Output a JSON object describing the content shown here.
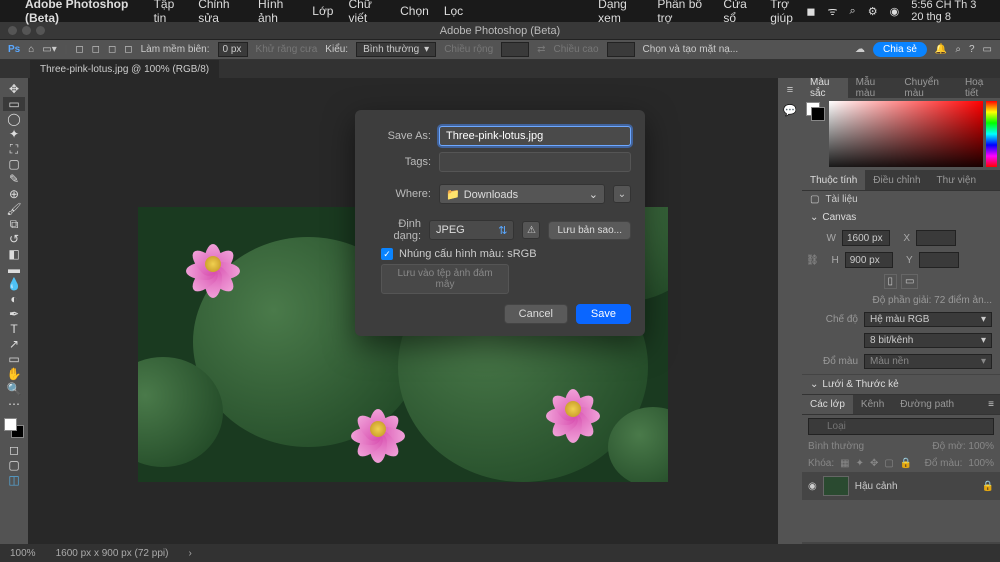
{
  "mac_menu": {
    "app": "Adobe Photoshop (Beta)",
    "items": [
      "Tập tin",
      "Chỉnh sửa",
      "Hình ảnh",
      "Lớp",
      "Chữ viết",
      "Chọn",
      "Lọc",
      "Dạng xem",
      "Phần bổ trợ",
      "Cửa sổ",
      "Trợ giúp"
    ],
    "clock": "5:56 CH Th 3 20 thg 8"
  },
  "window_title": "Adobe Photoshop (Beta)",
  "option_bar": {
    "feather_label": "Làm mềm biên:",
    "feather_value": "0 px",
    "antialias": "Khử răng cưa",
    "style_label": "Kiểu:",
    "style_value": "Bình thường",
    "width_label": "Chiều rộng",
    "height_label": "Chiều cao",
    "mask": "Chọn và tạo mặt nạ...",
    "share": "Chia sẻ"
  },
  "tab": {
    "title": "Three-pink-lotus.jpg @ 100% (RGB/8)"
  },
  "dialog": {
    "saveas_label": "Save As:",
    "filename": "Three-pink-lotus.jpg",
    "tags_label": "Tags:",
    "where_label": "Where:",
    "where_value": "Downloads",
    "format_label": "Định dạng:",
    "format_value": "JPEG",
    "copy_btn": "Lưu bản sao...",
    "embed": "Nhúng cấu hình màu: sRGB",
    "cloud": "Lưu vào tệp ảnh đám mây",
    "cancel": "Cancel",
    "save": "Save"
  },
  "panels": {
    "color_tabs": [
      "Màu sắc",
      "Mẫu màu",
      "Chuyển màu",
      "Hoạ tiết"
    ],
    "prop_tabs": [
      "Thuộc tính",
      "Điều chỉnh",
      "Thư viện"
    ],
    "doc_label": "Tài liệu",
    "canvas_label": "Canvas",
    "w": "W",
    "w_val": "1600 px",
    "x": "X",
    "h": "H",
    "h_val": "900 px",
    "y": "Y",
    "res": "Độ phần giải: 72 điểm ản...",
    "mode_lbl": "Chế độ",
    "mode_val": "Hệ màu RGB",
    "depth_val": "8 bit/kênh",
    "fill_lbl": "Đổ màu",
    "fill_val": "Màu nền",
    "ruler": "Lưới & Thước kẻ",
    "layer_tabs": [
      "Các lớp",
      "Kênh",
      "Đường path"
    ],
    "search_ph": "Loại",
    "blend": "Bình thường",
    "opacity_lbl": "Độ mờ:",
    "opacity_val": "100%",
    "lock_lbl": "Khóa:",
    "fill_op_lbl": "Đổ màu:",
    "fill_op_val": "100%",
    "layer_name": "Hậu cảnh"
  },
  "status": {
    "zoom": "100%",
    "dims": "1600 px x 900 px (72 ppi)"
  }
}
